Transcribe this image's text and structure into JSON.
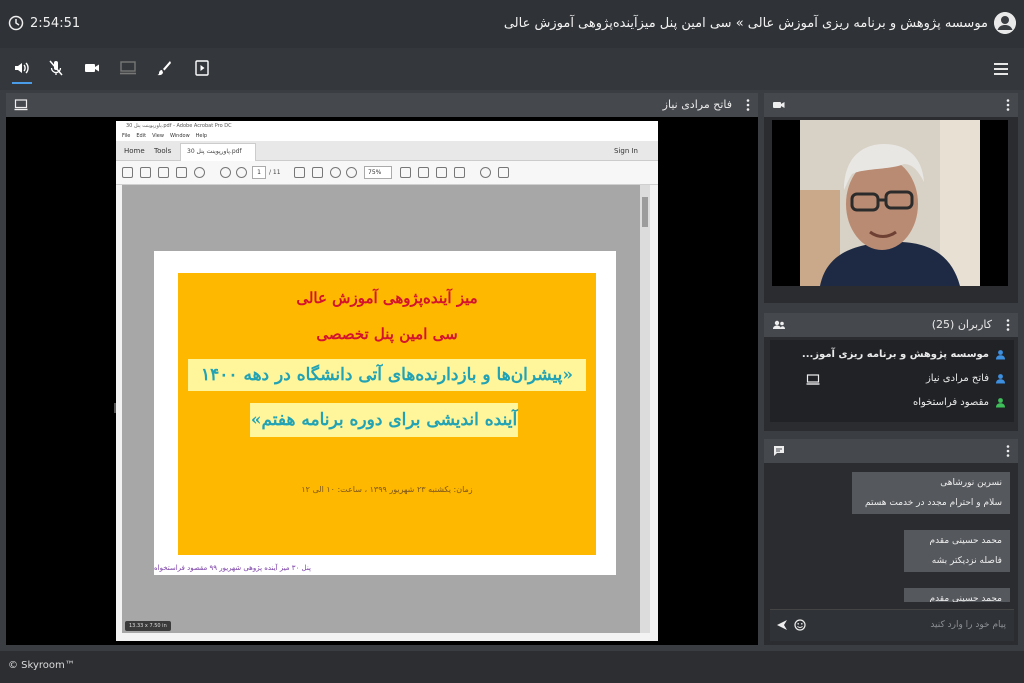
{
  "header": {
    "time": "2:54:51",
    "room_title": "موسسه پژوهش و برنامه ریزی آموزش عالی » سی امین پنل میزآینده‌پژوهی آموزش عالی"
  },
  "share_panel": {
    "title": "فاتح مرادی نیاز",
    "acrobat": {
      "window_title": "پاورپوینت پنل 30.pdf - Adobe Acrobat Pro DC",
      "menu": [
        "File",
        "Edit",
        "View",
        "Window",
        "Help"
      ],
      "tabs": {
        "home": "Home",
        "tools": "Tools",
        "doc": "پاورپوینت پنل 30.pdf",
        "sign_in": "Sign In"
      },
      "page_current": "1",
      "page_total": "/ 11",
      "zoom": "75%",
      "size_badge": "13.33 x 7.50 in"
    },
    "slide": {
      "line1": "میز آینده‌پژوهی آموزش عالی",
      "line2": "سی امین پنل تخصصی",
      "line3": "«پیشران‌ها و بازدارنده‌های آتی دانشگاه در دهه ۱۴۰۰",
      "line4": "آینده اندیشی برای دوره برنامه هفتم»",
      "line5": "زمان: یکشنبه ۲۳ شهریور ۱۳۹۹ ، ساعت: ۱۰ الی ۱۲"
    },
    "footer_note": "پنل ۳۰ میز آینده پژوهی  شهریور ۹۹ مقصود فراستخواه"
  },
  "users_panel": {
    "title": "کاربران (25)",
    "users": [
      {
        "name": "موسسه پژوهش و برنامه ریزی آموز...",
        "color": "#3d8fe0"
      },
      {
        "name": "فاتح مرادی نیاز",
        "color": "#3d8fe0"
      },
      {
        "name": "مقصود فراستخواه",
        "color": "#3fbf5a"
      }
    ]
  },
  "chat_panel": {
    "messages": [
      {
        "name": "نسرین نورشاهی",
        "text": "سلام و احترام مجدد در خدمت هستم"
      },
      {
        "name": "محمد حسینی مقدم",
        "text": "فاصله نزدیکتر بشه"
      },
      {
        "name": "محمد حسینی مقدم",
        "text": ""
      }
    ],
    "input_placeholder": "پیام خود را وارد کنید"
  },
  "footer": {
    "brand": "© Skyroom™"
  },
  "colors": {
    "accent": "#4a9be8",
    "slide_bg": "#ffb800",
    "slide_title": "#d4142e",
    "slide_highlight": "#22a3b5"
  }
}
